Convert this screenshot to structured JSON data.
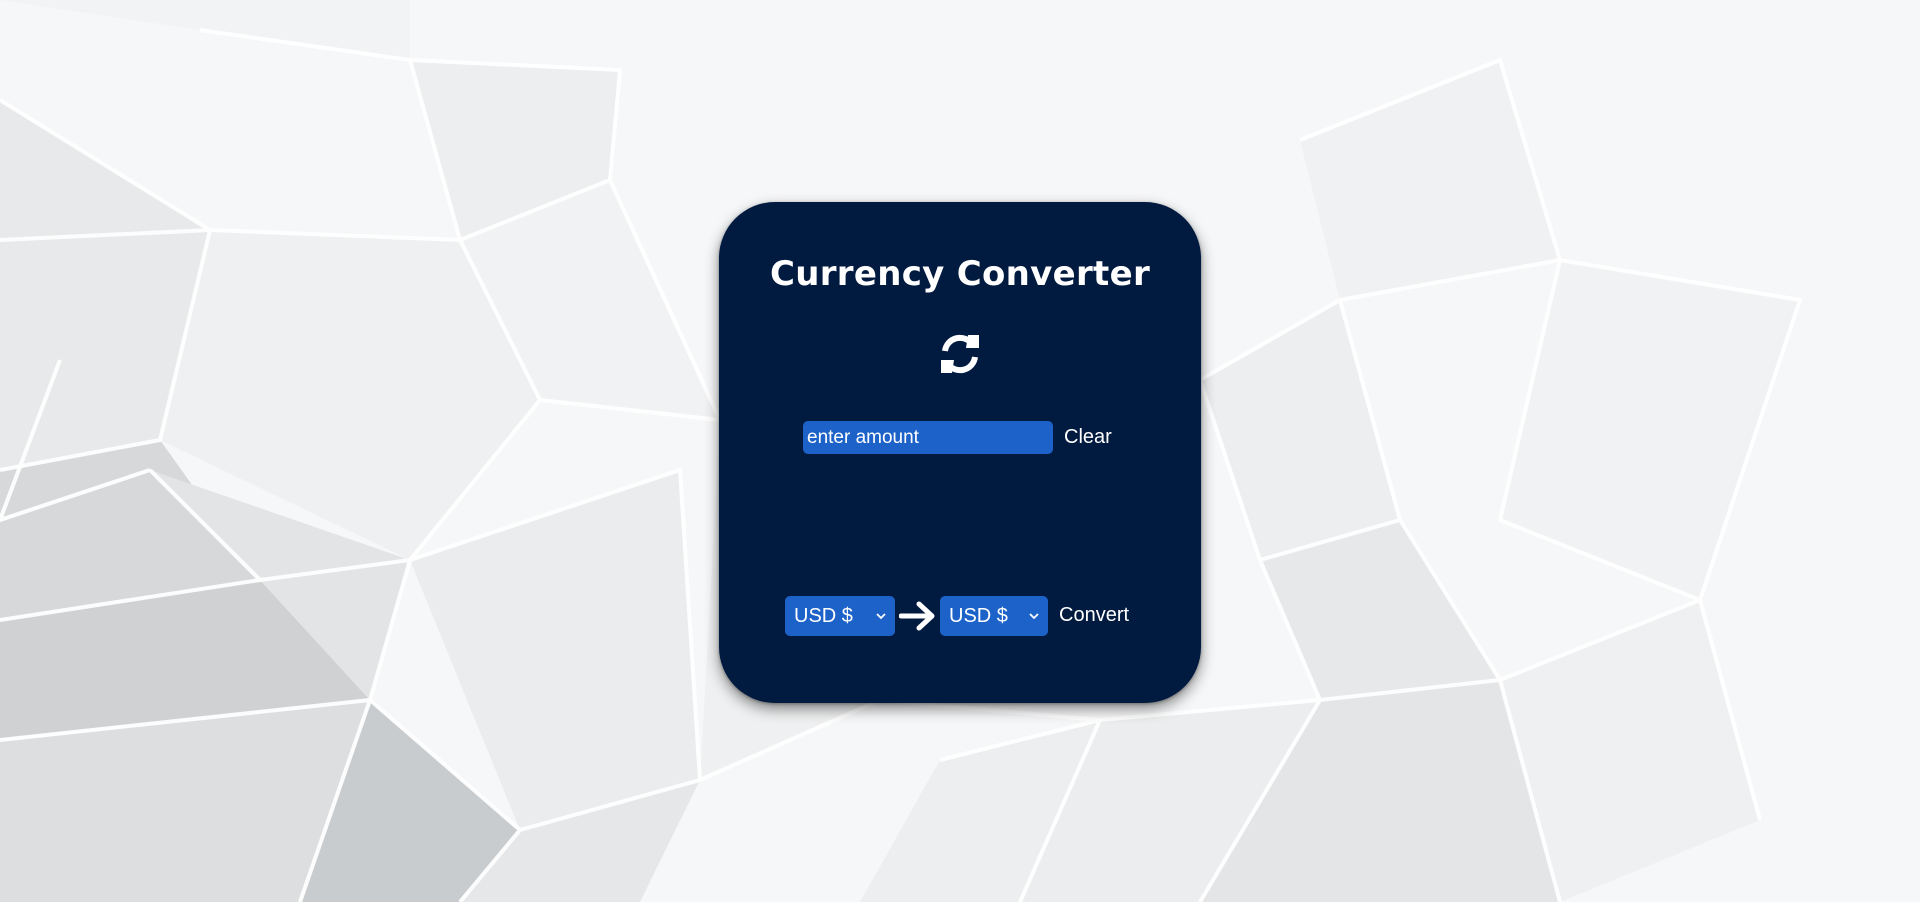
{
  "app": {
    "title": "Currency Converter"
  },
  "amount": {
    "placeholder": "enter amount",
    "value": ""
  },
  "buttons": {
    "clear_label": "Clear",
    "convert_label": "Convert"
  },
  "currency": {
    "from_selected": "USD $",
    "to_selected": "USD $"
  },
  "icons": {
    "refresh": "refresh-icon",
    "arrow": "arrow-right-icon",
    "dropdown": "chevron-down-icon"
  },
  "colors": {
    "card_background": "#011a40",
    "control_blue": "#1d62c8",
    "text": "#ffffff",
    "page_background": "#f4f5f6"
  }
}
